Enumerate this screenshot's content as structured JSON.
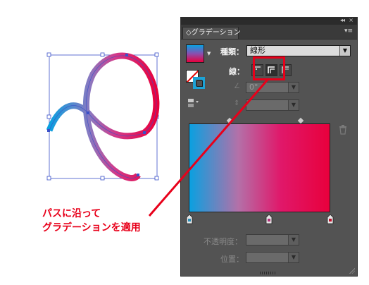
{
  "panel": {
    "tab_label": "◇グラデーション",
    "collapse_glyph": "◂◂",
    "close_glyph": "×",
    "menu_glyph": "▾≡",
    "type_label": "種類：",
    "type_value": "線形",
    "stroke_label": "線：",
    "angle_value": "0°",
    "ratio_value": "",
    "opacity_label": "不透明度：",
    "opacity_value": "",
    "position_label": "位置：",
    "position_value": ""
  },
  "gradient": {
    "colors": [
      "#0aa0e0",
      "#b470a8",
      "#e0186a",
      "#e8003c"
    ],
    "stops": [
      {
        "color": "#2a8fb8"
      },
      {
        "color": "#b4307a"
      },
      {
        "color": "#c0102c"
      }
    ]
  },
  "callout": {
    "line1": "パスに沿って",
    "line2": "グラデーションを適用",
    "color": "#e8001a"
  }
}
